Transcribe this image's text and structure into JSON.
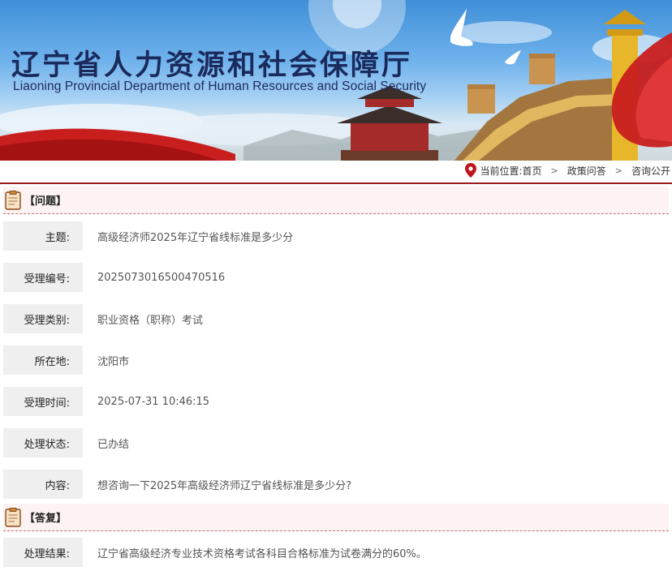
{
  "header": {
    "title_cn": "辽宁省人力资源和社会保障厅",
    "title_en": "Liaoning Provincial Department of Human Resources and Social Security"
  },
  "breadcrumb": {
    "prefix": "当前位置:",
    "items": [
      "首页",
      "政策问答",
      "咨询公开"
    ],
    "icon": "location-pin-icon",
    "separator_icon": "chevron-right-icon"
  },
  "question": {
    "section_label": "【问题】",
    "icon": "clipboard-icon",
    "rows": [
      {
        "key": "主题:",
        "value": "高级经济师2025年辽宁省线标准是多少分"
      },
      {
        "key": "受理编号:",
        "value": "2025073016500470516"
      },
      {
        "key": "受理类别:",
        "value": "职业资格（职称）考试"
      },
      {
        "key": "所在地:",
        "value": "沈阳市"
      },
      {
        "key": "受理时间:",
        "value": "2025-07-31 10:46:15"
      },
      {
        "key": "处理状态:",
        "value": "已办结"
      },
      {
        "key": "内容:",
        "value": "想咨询一下2025年高级经济师辽宁省线标准是多少分?"
      }
    ]
  },
  "answer": {
    "section_label": "【答复】",
    "icon": "clipboard-icon",
    "rows": [
      {
        "key": "处理结果:",
        "value": "辽宁省高级经济专业技术资格考试各科目合格标准为试卷满分的60%。"
      }
    ]
  },
  "colors": {
    "accent_red": "#9b1c1c",
    "section_bg": "#fdf3f3",
    "key_bg": "#efefef",
    "title_navy": "#1b2a5c"
  }
}
